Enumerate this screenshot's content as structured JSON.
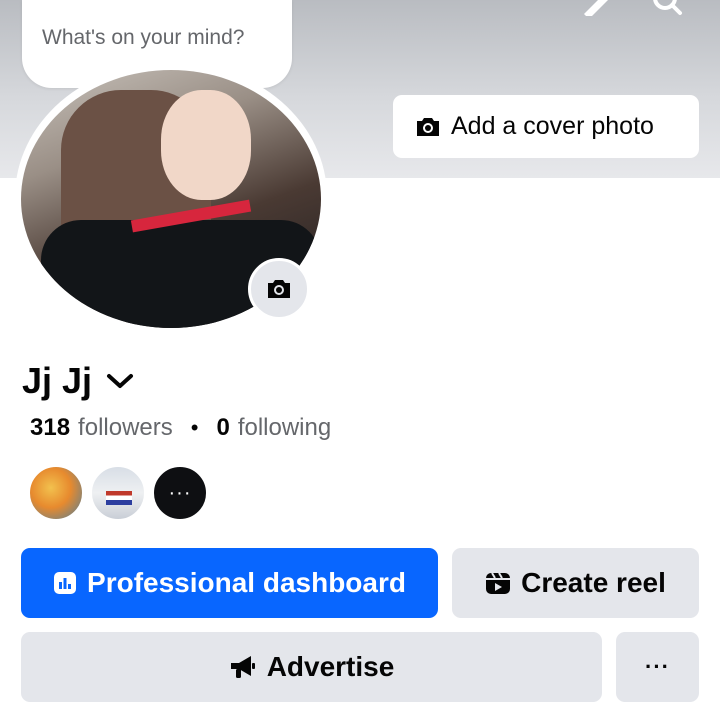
{
  "cover": {
    "add_cover_label": "Add a cover photo"
  },
  "status_bubble": {
    "placeholder": "What's on your mind?"
  },
  "profile": {
    "name": "Jj Jj",
    "followers_count": "318",
    "followers_label": "followers",
    "following_count": "0",
    "following_label": "following",
    "separator": "•"
  },
  "followers_preview": {
    "more_label": "···"
  },
  "actions": {
    "professional_dashboard": "Professional dashboard",
    "create_reel": "Create reel",
    "advertise": "Advertise",
    "more": "···"
  },
  "icons": {
    "camera": "camera-icon",
    "dashboard": "dashboard-icon",
    "reel": "reel-icon",
    "megaphone": "megaphone-icon",
    "chevron": "chevron-down-icon",
    "pencil": "pencil-icon",
    "search": "search-icon",
    "menu": "menu-icon"
  },
  "colors": {
    "primary": "#0866ff",
    "secondary_button": "#e4e6eb",
    "text_primary": "#050505",
    "text_secondary": "#65676b"
  }
}
